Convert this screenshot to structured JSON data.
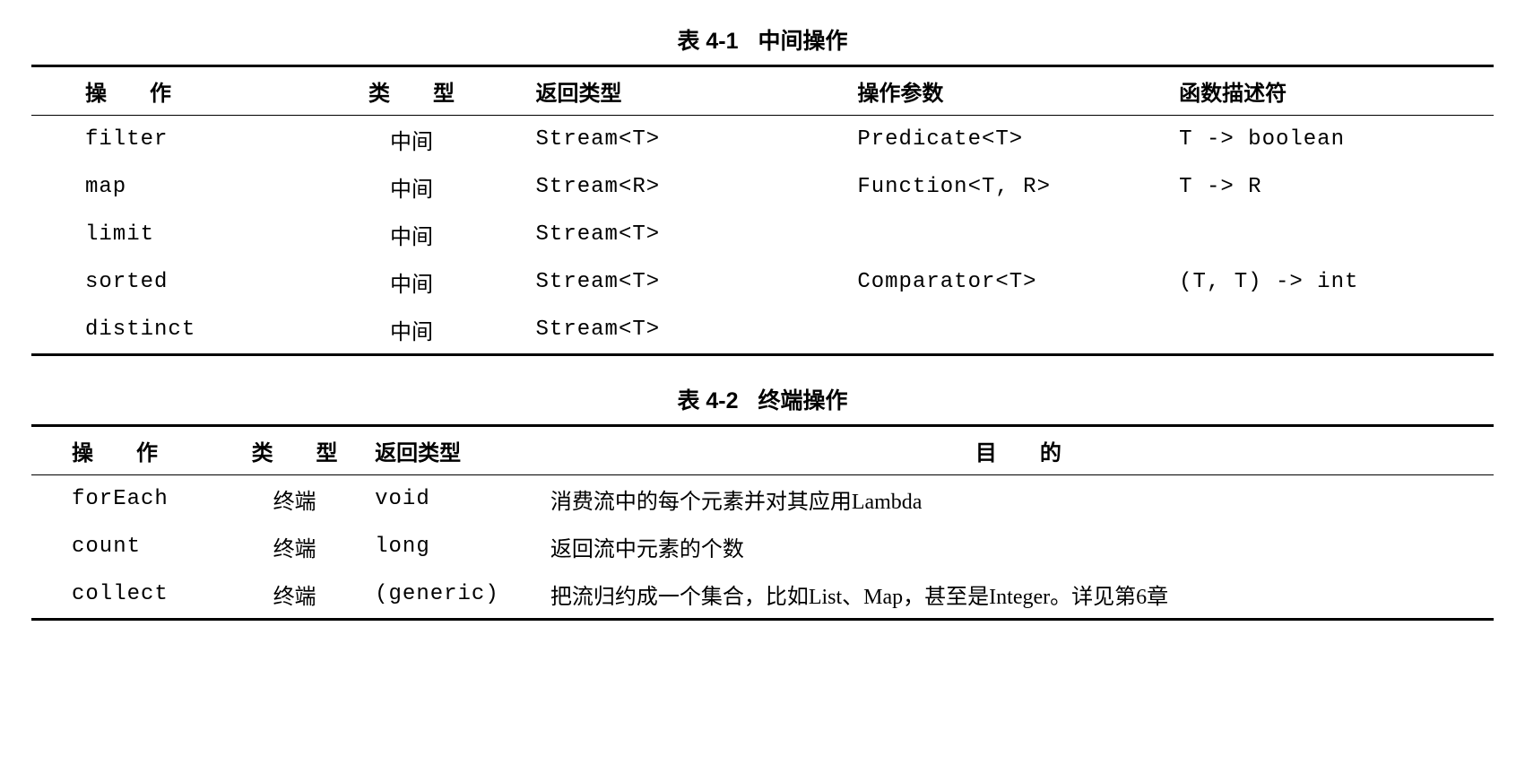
{
  "table1": {
    "caption_num": "表 4-1",
    "caption_title": "中间操作",
    "headers": {
      "op": "操　　作",
      "type": "类　　型",
      "ret": "返回类型",
      "param": "操作参数",
      "desc": "函数描述符"
    },
    "rows": [
      {
        "op": "filter",
        "type": "中间",
        "ret": "Stream<T>",
        "param": "Predicate<T>",
        "desc": "T -> boolean"
      },
      {
        "op": "map",
        "type": "中间",
        "ret": "Stream<R>",
        "param": "Function<T, R>",
        "desc": "T -> R"
      },
      {
        "op": "limit",
        "type": "中间",
        "ret": "Stream<T>",
        "param": "",
        "desc": ""
      },
      {
        "op": "sorted",
        "type": "中间",
        "ret": "Stream<T>",
        "param": "Comparator<T>",
        "desc": "(T, T) -> int"
      },
      {
        "op": "distinct",
        "type": "中间",
        "ret": "Stream<T>",
        "param": "",
        "desc": ""
      }
    ]
  },
  "table2": {
    "caption_num": "表 4-2",
    "caption_title": "终端操作",
    "headers": {
      "op": "操　　作",
      "type": "类　　型",
      "ret": "返回类型",
      "purpose": "目　　的"
    },
    "rows": [
      {
        "op": "forEach",
        "type": "终端",
        "ret": "void",
        "purpose": "消费流中的每个元素并对其应用Lambda"
      },
      {
        "op": "count",
        "type": "终端",
        "ret": "long",
        "purpose": "返回流中元素的个数"
      },
      {
        "op": "collect",
        "type": "终端",
        "ret": "(generic)",
        "purpose": "把流归约成一个集合，比如List、Map，甚至是Integer。详见第6章"
      }
    ]
  }
}
